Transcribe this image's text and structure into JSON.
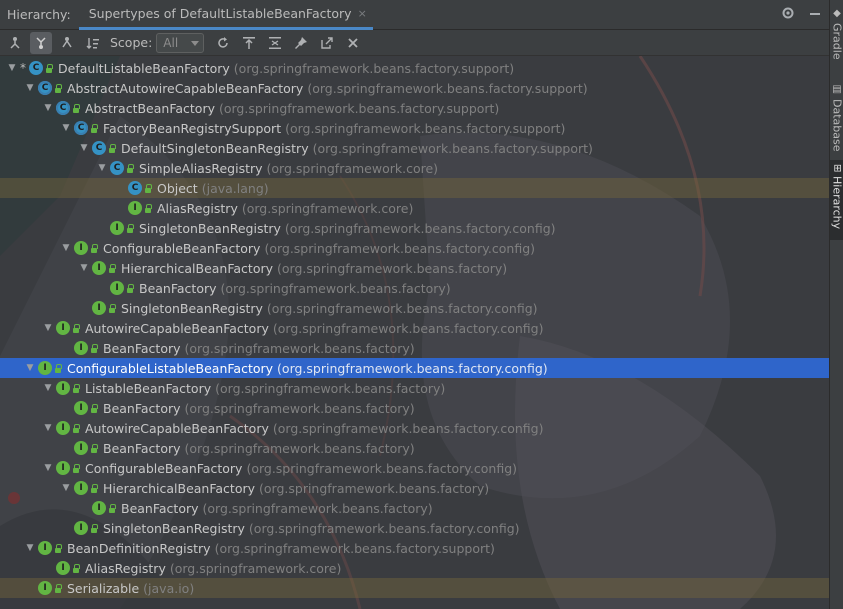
{
  "header": {
    "title": "Hierarchy:",
    "tab_label": "Supertypes of DefaultListableBeanFactory",
    "tab_close": "×",
    "settings_icon": "gear-icon",
    "minimize_icon": "minimize-icon"
  },
  "toolbar": {
    "scope_label": "Scope:",
    "scope_value": "All",
    "buttons": [
      "subtypes-hierarchy-icon",
      "supertypes-hierarchy-icon",
      "class-hierarchy-icon",
      "sort-alphabetically-icon",
      "refresh-icon",
      "scroll-to-source-icon",
      "collapse-all-icon",
      "pin-icon",
      "export-icon",
      "close-icon"
    ]
  },
  "tree": [
    {
      "indent": 0,
      "arrow": "down",
      "star": true,
      "kind": "c",
      "name": "DefaultListableBeanFactory",
      "pkg": "(org.springframework.beans.factory.support)"
    },
    {
      "indent": 1,
      "arrow": "down",
      "star": false,
      "kind": "a",
      "name": "AbstractAutowireCapableBeanFactory",
      "pkg": "(org.springframework.beans.factory.support)"
    },
    {
      "indent": 2,
      "arrow": "down",
      "star": false,
      "kind": "a",
      "name": "AbstractBeanFactory",
      "pkg": "(org.springframework.beans.factory.support)"
    },
    {
      "indent": 3,
      "arrow": "down",
      "star": false,
      "kind": "a",
      "name": "FactoryBeanRegistrySupport",
      "pkg": "(org.springframework.beans.factory.support)"
    },
    {
      "indent": 4,
      "arrow": "down",
      "star": false,
      "kind": "c",
      "name": "DefaultSingletonBeanRegistry",
      "pkg": "(org.springframework.beans.factory.support)"
    },
    {
      "indent": 5,
      "arrow": "down",
      "star": false,
      "kind": "c",
      "name": "SimpleAliasRegistry",
      "pkg": "(org.springframework.core)"
    },
    {
      "indent": 6,
      "arrow": "none",
      "star": false,
      "kind": "c",
      "name": "Object",
      "pkg": "(java.lang)",
      "highlight": true
    },
    {
      "indent": 6,
      "arrow": "none",
      "star": false,
      "kind": "i",
      "name": "AliasRegistry",
      "pkg": "(org.springframework.core)"
    },
    {
      "indent": 5,
      "arrow": "none",
      "star": false,
      "kind": "i",
      "name": "SingletonBeanRegistry",
      "pkg": "(org.springframework.beans.factory.config)"
    },
    {
      "indent": 3,
      "arrow": "down",
      "star": false,
      "kind": "i",
      "name": "ConfigurableBeanFactory",
      "pkg": "(org.springframework.beans.factory.config)"
    },
    {
      "indent": 4,
      "arrow": "down",
      "star": false,
      "kind": "i",
      "name": "HierarchicalBeanFactory",
      "pkg": "(org.springframework.beans.factory)"
    },
    {
      "indent": 5,
      "arrow": "none",
      "star": false,
      "kind": "i",
      "name": "BeanFactory",
      "pkg": "(org.springframework.beans.factory)"
    },
    {
      "indent": 4,
      "arrow": "none",
      "star": false,
      "kind": "i",
      "name": "SingletonBeanRegistry",
      "pkg": "(org.springframework.beans.factory.config)"
    },
    {
      "indent": 2,
      "arrow": "down",
      "star": false,
      "kind": "i",
      "name": "AutowireCapableBeanFactory",
      "pkg": "(org.springframework.beans.factory.config)"
    },
    {
      "indent": 3,
      "arrow": "none",
      "star": false,
      "kind": "i",
      "name": "BeanFactory",
      "pkg": "(org.springframework.beans.factory)"
    },
    {
      "indent": 1,
      "arrow": "down",
      "star": false,
      "kind": "i",
      "name": "ConfigurableListableBeanFactory",
      "pkg": "(org.springframework.beans.factory.config)",
      "selected": true
    },
    {
      "indent": 2,
      "arrow": "down",
      "star": false,
      "kind": "i",
      "name": "ListableBeanFactory",
      "pkg": "(org.springframework.beans.factory)"
    },
    {
      "indent": 3,
      "arrow": "none",
      "star": false,
      "kind": "i",
      "name": "BeanFactory",
      "pkg": "(org.springframework.beans.factory)"
    },
    {
      "indent": 2,
      "arrow": "down",
      "star": false,
      "kind": "i",
      "name": "AutowireCapableBeanFactory",
      "pkg": "(org.springframework.beans.factory.config)"
    },
    {
      "indent": 3,
      "arrow": "none",
      "star": false,
      "kind": "i",
      "name": "BeanFactory",
      "pkg": "(org.springframework.beans.factory)"
    },
    {
      "indent": 2,
      "arrow": "down",
      "star": false,
      "kind": "i",
      "name": "ConfigurableBeanFactory",
      "pkg": "(org.springframework.beans.factory.config)"
    },
    {
      "indent": 3,
      "arrow": "down",
      "star": false,
      "kind": "i",
      "name": "HierarchicalBeanFactory",
      "pkg": "(org.springframework.beans.factory)"
    },
    {
      "indent": 4,
      "arrow": "none",
      "star": false,
      "kind": "i",
      "name": "BeanFactory",
      "pkg": "(org.springframework.beans.factory)"
    },
    {
      "indent": 3,
      "arrow": "none",
      "star": false,
      "kind": "i",
      "name": "SingletonBeanRegistry",
      "pkg": "(org.springframework.beans.factory.config)"
    },
    {
      "indent": 1,
      "arrow": "down",
      "star": false,
      "kind": "i",
      "name": "BeanDefinitionRegistry",
      "pkg": "(org.springframework.beans.factory.support)"
    },
    {
      "indent": 2,
      "arrow": "none",
      "star": false,
      "kind": "i",
      "name": "AliasRegistry",
      "pkg": "(org.springframework.core)"
    },
    {
      "indent": 1,
      "arrow": "none",
      "star": false,
      "kind": "i",
      "name": "Serializable",
      "pkg": "(java.io)",
      "highlight": true
    }
  ],
  "side_tabs": [
    {
      "label": "Gradle",
      "icon": "gradle-icon"
    },
    {
      "label": "Database",
      "icon": "database-icon"
    },
    {
      "label": "Hierarchy",
      "icon": "hierarchy-icon",
      "active": true
    }
  ],
  "colors": {
    "selection": "#2f65ca",
    "class_icon": "#3592c4",
    "interface_icon": "#62b543",
    "package_text": "#808080"
  }
}
